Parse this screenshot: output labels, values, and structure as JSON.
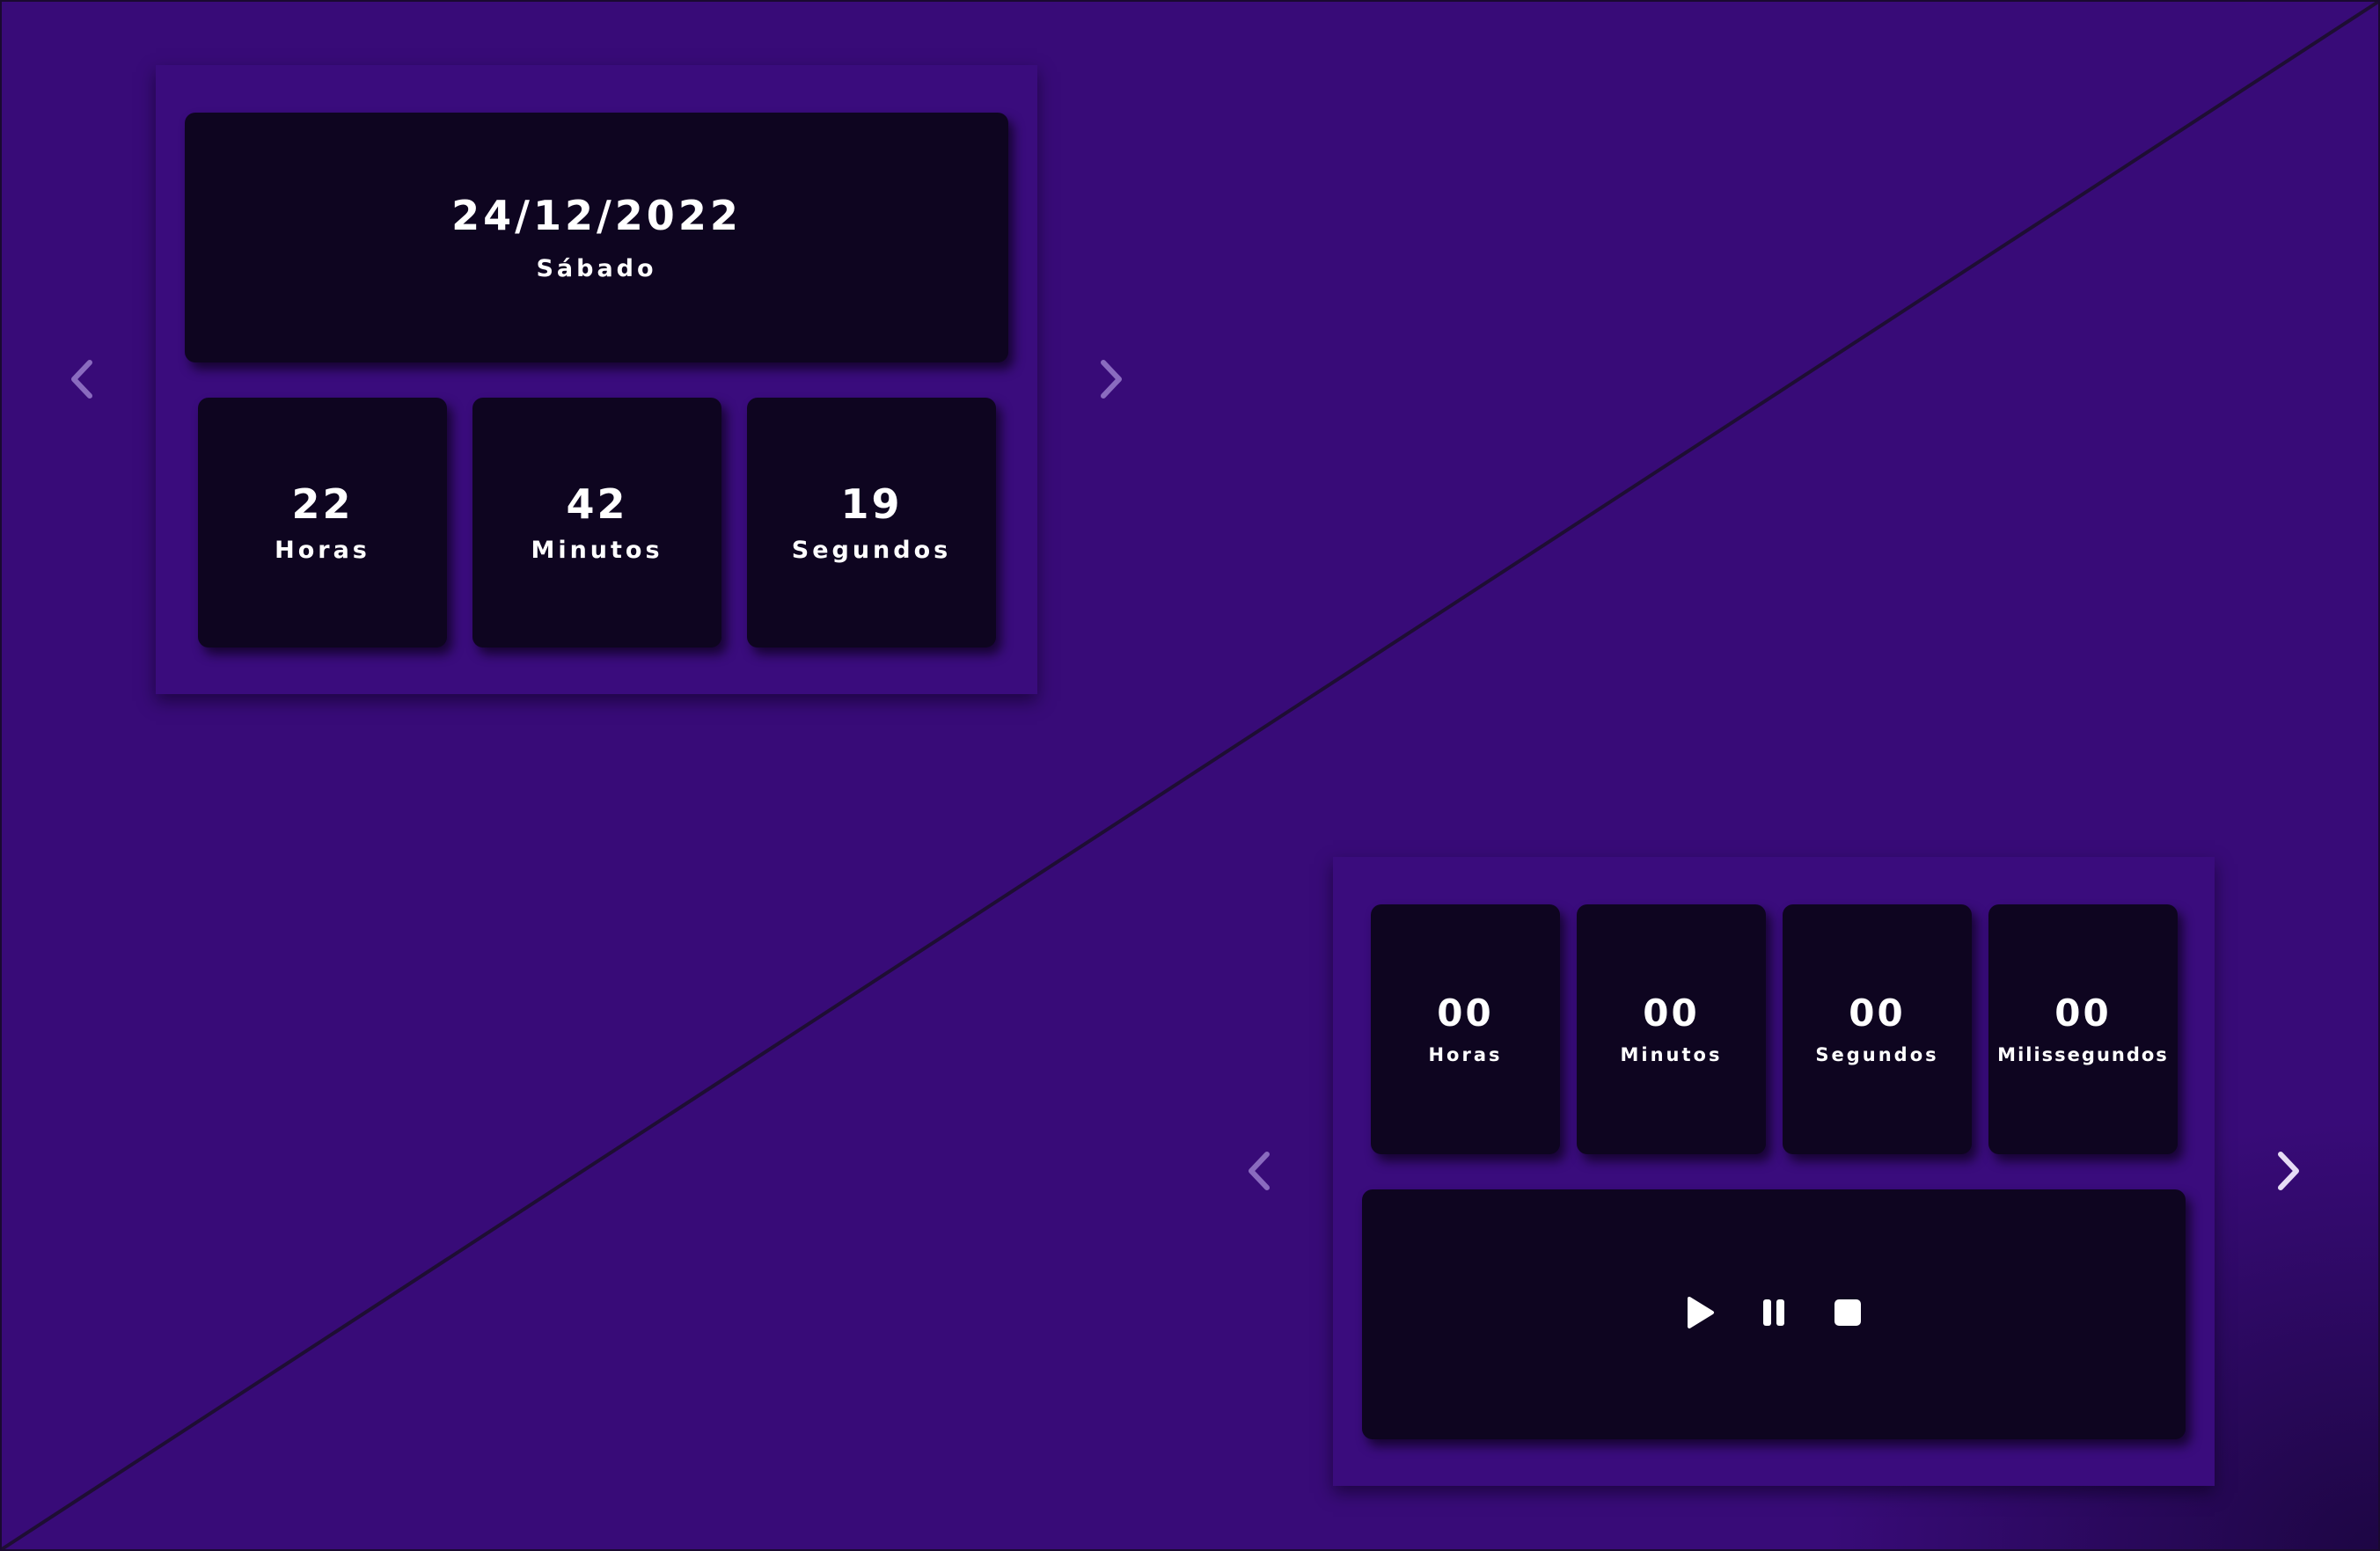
{
  "clock": {
    "date": "24/12/2022",
    "weekday": "Sábado",
    "units": [
      {
        "value": "22",
        "label": "Horas"
      },
      {
        "value": "42",
        "label": "Minutos"
      },
      {
        "value": "19",
        "label": "Segundos"
      }
    ]
  },
  "stopwatch": {
    "units": [
      {
        "value": "00",
        "label": "Horas"
      },
      {
        "value": "00",
        "label": "Minutos"
      },
      {
        "value": "00",
        "label": "Segundos"
      },
      {
        "value": "00",
        "label": "Milissegundos"
      }
    ],
    "controls": [
      "play-icon",
      "pause-icon",
      "stop-icon"
    ]
  },
  "icons": {
    "prev": "chevron-left-icon",
    "next": "chevron-right-icon"
  },
  "colors": {
    "background": "#380b78",
    "panel": "#3a0c7d",
    "card": "#0e0520",
    "text": "#ffffff",
    "arrow_dim": "#8a6bbf",
    "arrow_bright": "#e6dcf5"
  }
}
